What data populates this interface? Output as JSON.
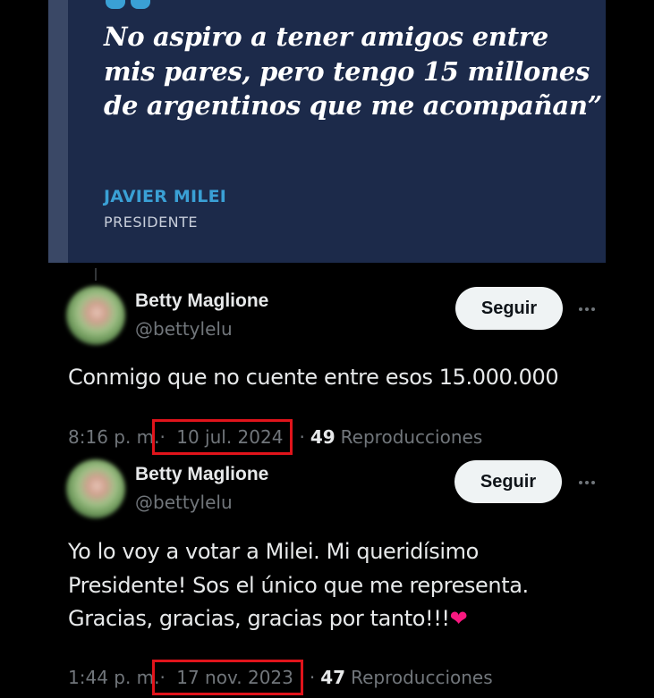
{
  "quote_image": {
    "text": "No aspiro a tener amigos entre mis pares, pero tengo 15 millones de argentinos que me acompañan”",
    "author": "JAVIER MILEI",
    "role": "PRESIDENTE",
    "accent_color": "#3aa0d5",
    "background_color": "#1c2a4a"
  },
  "tweets": [
    {
      "display_name": "Betty Maglione",
      "handle": "@bettylelu",
      "follow_label": "Seguir",
      "more_icon": "more-horizontal-icon",
      "text": "Conmigo que no cuente entre esos 15.000.000",
      "time": "8:16 p. m.",
      "separator": "·",
      "date": "10 jul. 2024",
      "views": "49",
      "views_label": "Reproducciones"
    },
    {
      "display_name": "Betty Maglione",
      "handle": "@bettylelu",
      "follow_label": "Seguir",
      "more_icon": "more-horizontal-icon",
      "text": "Yo lo voy a votar a Milei. Mi queridísimo Presidente! Sos el único que me representa. Gracias, gracias, gracias por tanto!!!",
      "emoji": "❤",
      "time": "1:44 p. m.",
      "separator": "·",
      "date": "17 nov. 2023",
      "views": "47",
      "views_label": "Reproducciones"
    }
  ],
  "highlight_color": "#e0141b"
}
